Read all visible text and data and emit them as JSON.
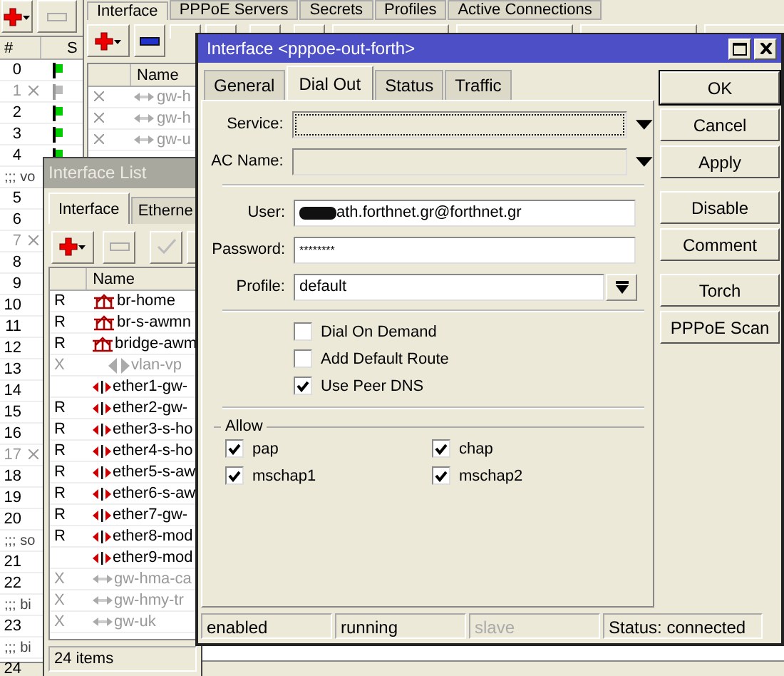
{
  "address_list": {
    "columns": [
      "#",
      "S"
    ],
    "rows": [
      {
        "kind": "item",
        "number": "0",
        "disabled": false,
        "running": true
      },
      {
        "kind": "item",
        "number": "1",
        "disabled": true,
        "running": false
      },
      {
        "kind": "item",
        "number": "2",
        "disabled": false,
        "running": true
      },
      {
        "kind": "item",
        "number": "3",
        "disabled": false,
        "running": true
      },
      {
        "kind": "item",
        "number": "4",
        "disabled": false,
        "running": true
      },
      {
        "kind": "comment",
        "text": ";;; vo"
      },
      {
        "kind": "item",
        "number": "5",
        "disabled": false
      },
      {
        "kind": "item",
        "number": "6",
        "disabled": false
      },
      {
        "kind": "item",
        "number": "7",
        "disabled": true
      },
      {
        "kind": "item",
        "number": "8",
        "disabled": false
      },
      {
        "kind": "item",
        "number": "9",
        "disabled": false
      },
      {
        "kind": "item",
        "number": "10",
        "disabled": false
      },
      {
        "kind": "item",
        "number": "11",
        "disabled": false
      },
      {
        "kind": "item",
        "number": "12",
        "disabled": false
      },
      {
        "kind": "item",
        "number": "13",
        "disabled": false
      },
      {
        "kind": "item",
        "number": "14",
        "disabled": false
      },
      {
        "kind": "item",
        "number": "15",
        "disabled": false
      },
      {
        "kind": "item",
        "number": "16",
        "disabled": false
      },
      {
        "kind": "item",
        "number": "17",
        "disabled": true
      },
      {
        "kind": "item",
        "number": "18",
        "disabled": false
      },
      {
        "kind": "item",
        "number": "19",
        "disabled": false
      },
      {
        "kind": "item",
        "number": "20",
        "disabled": false
      },
      {
        "kind": "comment",
        "text": ";;; so"
      },
      {
        "kind": "item",
        "number": "21",
        "disabled": false
      },
      {
        "kind": "item",
        "number": "22",
        "disabled": false
      },
      {
        "kind": "comment",
        "text": ";;; bi"
      },
      {
        "kind": "item",
        "number": "23",
        "disabled": false
      },
      {
        "kind": "comment",
        "text": ";;; bi"
      },
      {
        "kind": "item",
        "number": "24",
        "disabled": false
      }
    ]
  },
  "pppoe_window": {
    "tabs": [
      {
        "label": "Interface",
        "selected": true
      },
      {
        "label": "PPPoE Servers",
        "selected": false
      },
      {
        "label": "Secrets",
        "selected": false
      },
      {
        "label": "Profiles",
        "selected": false
      },
      {
        "label": "Active Connections",
        "selected": false
      }
    ],
    "columns": [
      "Name"
    ],
    "rows": [
      {
        "name": "gw-h",
        "disabled": true
      },
      {
        "name": "gw-h",
        "disabled": true
      },
      {
        "name": "gw-u",
        "disabled": true
      }
    ]
  },
  "interface_list": {
    "title": "Interface List",
    "tabs": [
      {
        "label": "Interface",
        "selected": true
      },
      {
        "label": "Etherne",
        "selected": false
      }
    ],
    "columns": [
      "Name"
    ],
    "rows": [
      {
        "flag": "R",
        "kind": "bridge",
        "name": "br-home",
        "disabled": false
      },
      {
        "flag": "R",
        "kind": "bridge",
        "name": "br-s-awmn",
        "disabled": false
      },
      {
        "flag": "R",
        "kind": "bridge",
        "name": "bridge-awm",
        "disabled": false
      },
      {
        "flag": "X",
        "kind": "vlan",
        "name": "vlan-vp",
        "disabled": true
      },
      {
        "kind": "ether",
        "name": "ether1-gw-",
        "disabled": false
      },
      {
        "flag": "R",
        "kind": "ether",
        "name": "ether2-gw-",
        "disabled": false
      },
      {
        "flag": "R",
        "kind": "ether",
        "name": "ether3-s-ho",
        "disabled": false
      },
      {
        "flag": "R",
        "kind": "ether",
        "name": "ether4-s-ho",
        "disabled": false
      },
      {
        "flag": "R",
        "kind": "ether",
        "name": "ether5-s-aw",
        "disabled": false
      },
      {
        "flag": "R",
        "kind": "ether",
        "name": "ether6-s-aw",
        "disabled": false
      },
      {
        "flag": "R",
        "kind": "ether",
        "name": "ether7-gw-",
        "disabled": false
      },
      {
        "flag": "R",
        "kind": "ether",
        "name": "ether8-mod",
        "disabled": false
      },
      {
        "kind": "ether",
        "name": "ether9-mod",
        "disabled": false
      },
      {
        "flag": "X",
        "kind": "pppoe",
        "name": "gw-hma-ca",
        "disabled": true
      },
      {
        "flag": "X",
        "kind": "pppoe",
        "name": "gw-hmy-tr",
        "disabled": true
      },
      {
        "flag": "X",
        "kind": "pppoe",
        "name": "gw-uk",
        "disabled": true
      }
    ],
    "status_bar": "24 items"
  },
  "dialog": {
    "title": "Interface <pppoe-out-forth>",
    "tabs": [
      {
        "label": "General",
        "selected": false
      },
      {
        "label": "Dial Out",
        "selected": true
      },
      {
        "label": "Status",
        "selected": false
      },
      {
        "label": "Traffic",
        "selected": false
      }
    ],
    "fields": [
      {
        "label": "Service:",
        "kind": "dropdown",
        "focused": true
      },
      {
        "label": "AC Name:",
        "kind": "dropdown",
        "focused": false
      },
      {
        "kind": "separator"
      },
      {
        "label": "User:",
        "kind": "text",
        "value": "ath.forthnet.gr@forthnet.gr",
        "redacted": true,
        "focused": false
      },
      {
        "label": "Password:",
        "kind": "password",
        "value": "********",
        "focused": false
      },
      {
        "label": "Profile:",
        "kind": "select",
        "value": "default",
        "focused": false
      }
    ],
    "options": [
      {
        "label": "Dial On Demand",
        "checked": false
      },
      {
        "label": "Add Default Route",
        "checked": false
      },
      {
        "label": "Use Peer DNS",
        "checked": true
      }
    ],
    "allow": {
      "title": "Allow",
      "items": [
        {
          "label": "pap",
          "checked": true
        },
        {
          "label": "chap",
          "checked": true
        },
        {
          "label": "mschap1",
          "checked": true
        },
        {
          "label": "mschap2",
          "checked": true
        }
      ]
    },
    "buttons": [
      {
        "label": "OK",
        "default": true
      },
      {
        "label": "Cancel",
        "default": false
      },
      {
        "label": "Apply",
        "default": false
      },
      {
        "label": "Disable",
        "default": false
      },
      {
        "label": "Comment",
        "default": false
      },
      {
        "label": "Torch",
        "default": false
      },
      {
        "label": "PPPoE Scan",
        "default": false
      }
    ],
    "status_bar": [
      {
        "text": "enabled",
        "disabled": false
      },
      {
        "text": "running",
        "disabled": false
      },
      {
        "text": "slave",
        "disabled": true
      },
      {
        "text": "Status: connected",
        "disabled": false
      }
    ]
  }
}
